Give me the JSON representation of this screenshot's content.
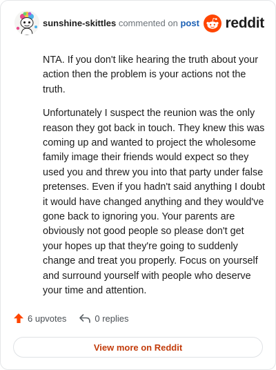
{
  "comment": {
    "username": "sunshine-skittles",
    "commented_on_text": "commented on",
    "post_link_text": "post",
    "paragraphs": [
      "NTA. If you don't like hearing the truth about your action then the problem is your actions not the truth.",
      "Unfortunately I suspect the reunion was the only reason they got back in touch. They knew this was coming up and wanted to project the wholesome family image their friends would expect so they used you and threw you into that party under false pretenses. Even if you hadn't said anything I doubt it would have changed anything and they would've gone back to ignoring you. Your parents are obviously not good people so please don't get your hopes up that they're going to suddenly change and treat you properly. Focus on yourself and surround yourself with people who deserve your time and attention."
    ]
  },
  "brand": {
    "wordmark": "reddit",
    "icon": "reddit-snoo-icon",
    "color": "#ff4500"
  },
  "actions": {
    "upvotes_label": "6 upvotes",
    "replies_label": "0 replies",
    "upvote_icon": "upvote-arrow-icon",
    "reply_icon": "reply-arrow-icon",
    "upvote_color": "#ff4500"
  },
  "footer": {
    "view_more_label": "View more on Reddit",
    "accent_color": "#c23b0a"
  }
}
